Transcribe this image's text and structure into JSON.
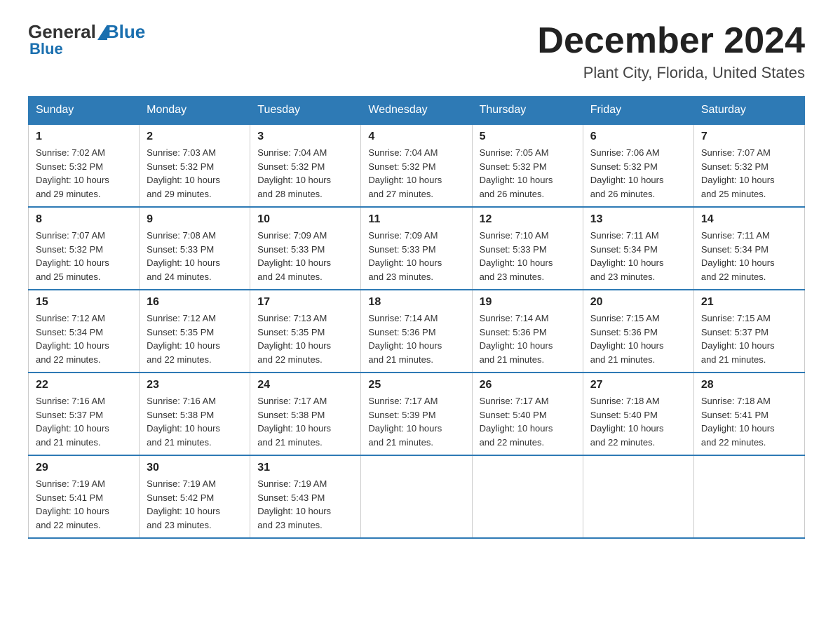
{
  "header": {
    "logo_general": "General",
    "logo_blue": "Blue",
    "month_title": "December 2024",
    "location": "Plant City, Florida, United States"
  },
  "days_of_week": [
    "Sunday",
    "Monday",
    "Tuesday",
    "Wednesday",
    "Thursday",
    "Friday",
    "Saturday"
  ],
  "weeks": [
    [
      {
        "day": "1",
        "sunrise": "7:02 AM",
        "sunset": "5:32 PM",
        "daylight": "10 hours and 29 minutes."
      },
      {
        "day": "2",
        "sunrise": "7:03 AM",
        "sunset": "5:32 PM",
        "daylight": "10 hours and 29 minutes."
      },
      {
        "day": "3",
        "sunrise": "7:04 AM",
        "sunset": "5:32 PM",
        "daylight": "10 hours and 28 minutes."
      },
      {
        "day": "4",
        "sunrise": "7:04 AM",
        "sunset": "5:32 PM",
        "daylight": "10 hours and 27 minutes."
      },
      {
        "day": "5",
        "sunrise": "7:05 AM",
        "sunset": "5:32 PM",
        "daylight": "10 hours and 26 minutes."
      },
      {
        "day": "6",
        "sunrise": "7:06 AM",
        "sunset": "5:32 PM",
        "daylight": "10 hours and 26 minutes."
      },
      {
        "day": "7",
        "sunrise": "7:07 AM",
        "sunset": "5:32 PM",
        "daylight": "10 hours and 25 minutes."
      }
    ],
    [
      {
        "day": "8",
        "sunrise": "7:07 AM",
        "sunset": "5:32 PM",
        "daylight": "10 hours and 25 minutes."
      },
      {
        "day": "9",
        "sunrise": "7:08 AM",
        "sunset": "5:33 PM",
        "daylight": "10 hours and 24 minutes."
      },
      {
        "day": "10",
        "sunrise": "7:09 AM",
        "sunset": "5:33 PM",
        "daylight": "10 hours and 24 minutes."
      },
      {
        "day": "11",
        "sunrise": "7:09 AM",
        "sunset": "5:33 PM",
        "daylight": "10 hours and 23 minutes."
      },
      {
        "day": "12",
        "sunrise": "7:10 AM",
        "sunset": "5:33 PM",
        "daylight": "10 hours and 23 minutes."
      },
      {
        "day": "13",
        "sunrise": "7:11 AM",
        "sunset": "5:34 PM",
        "daylight": "10 hours and 23 minutes."
      },
      {
        "day": "14",
        "sunrise": "7:11 AM",
        "sunset": "5:34 PM",
        "daylight": "10 hours and 22 minutes."
      }
    ],
    [
      {
        "day": "15",
        "sunrise": "7:12 AM",
        "sunset": "5:34 PM",
        "daylight": "10 hours and 22 minutes."
      },
      {
        "day": "16",
        "sunrise": "7:12 AM",
        "sunset": "5:35 PM",
        "daylight": "10 hours and 22 minutes."
      },
      {
        "day": "17",
        "sunrise": "7:13 AM",
        "sunset": "5:35 PM",
        "daylight": "10 hours and 22 minutes."
      },
      {
        "day": "18",
        "sunrise": "7:14 AM",
        "sunset": "5:36 PM",
        "daylight": "10 hours and 21 minutes."
      },
      {
        "day": "19",
        "sunrise": "7:14 AM",
        "sunset": "5:36 PM",
        "daylight": "10 hours and 21 minutes."
      },
      {
        "day": "20",
        "sunrise": "7:15 AM",
        "sunset": "5:36 PM",
        "daylight": "10 hours and 21 minutes."
      },
      {
        "day": "21",
        "sunrise": "7:15 AM",
        "sunset": "5:37 PM",
        "daylight": "10 hours and 21 minutes."
      }
    ],
    [
      {
        "day": "22",
        "sunrise": "7:16 AM",
        "sunset": "5:37 PM",
        "daylight": "10 hours and 21 minutes."
      },
      {
        "day": "23",
        "sunrise": "7:16 AM",
        "sunset": "5:38 PM",
        "daylight": "10 hours and 21 minutes."
      },
      {
        "day": "24",
        "sunrise": "7:17 AM",
        "sunset": "5:38 PM",
        "daylight": "10 hours and 21 minutes."
      },
      {
        "day": "25",
        "sunrise": "7:17 AM",
        "sunset": "5:39 PM",
        "daylight": "10 hours and 21 minutes."
      },
      {
        "day": "26",
        "sunrise": "7:17 AM",
        "sunset": "5:40 PM",
        "daylight": "10 hours and 22 minutes."
      },
      {
        "day": "27",
        "sunrise": "7:18 AM",
        "sunset": "5:40 PM",
        "daylight": "10 hours and 22 minutes."
      },
      {
        "day": "28",
        "sunrise": "7:18 AM",
        "sunset": "5:41 PM",
        "daylight": "10 hours and 22 minutes."
      }
    ],
    [
      {
        "day": "29",
        "sunrise": "7:19 AM",
        "sunset": "5:41 PM",
        "daylight": "10 hours and 22 minutes."
      },
      {
        "day": "30",
        "sunrise": "7:19 AM",
        "sunset": "5:42 PM",
        "daylight": "10 hours and 23 minutes."
      },
      {
        "day": "31",
        "sunrise": "7:19 AM",
        "sunset": "5:43 PM",
        "daylight": "10 hours and 23 minutes."
      },
      null,
      null,
      null,
      null
    ]
  ],
  "labels": {
    "sunrise": "Sunrise:",
    "sunset": "Sunset:",
    "daylight": "Daylight:"
  }
}
